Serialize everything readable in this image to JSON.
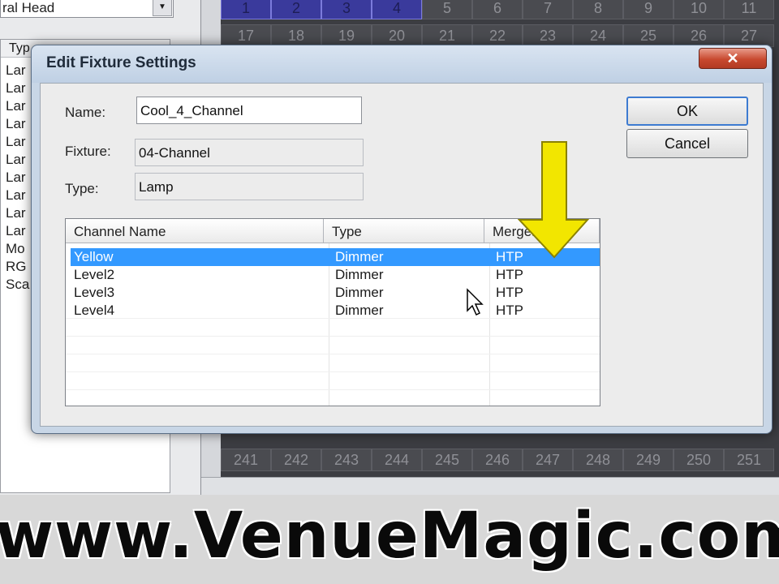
{
  "background": {
    "fixture_combo_text": "ral Head",
    "list_header": "Typ",
    "list_items": [
      "Lar",
      "Lar",
      "Lar",
      "Lar",
      "Lar",
      "Lar",
      "Lar",
      "Lar",
      "Lar",
      "Lar",
      "Mo",
      "RG",
      "Sca"
    ],
    "grid_top_rows": [
      [
        "1",
        "2",
        "3",
        "4",
        "5",
        "6",
        "7",
        "8",
        "9",
        "10",
        "11"
      ],
      [
        "17",
        "18",
        "19",
        "20",
        "21",
        "22",
        "23",
        "24",
        "25",
        "26",
        "27"
      ]
    ],
    "grid_bottom_row": [
      "241",
      "242",
      "243",
      "244",
      "245",
      "246",
      "247",
      "248",
      "249",
      "250",
      "251"
    ]
  },
  "dialog": {
    "title": "Edit Fixture Settings",
    "close_glyph": "✕",
    "name_label": "Name:",
    "name_value": "Cool_4_Channel",
    "fixture_label": "Fixture:",
    "fixture_value": "04-Channel",
    "type_label": "Type:",
    "type_value": "Lamp",
    "ok_label": "OK",
    "cancel_label": "Cancel",
    "table": {
      "columns": [
        "Channel Name",
        "Type",
        "MergeMode"
      ],
      "rows": [
        {
          "name": "Yellow",
          "type": "Dimmer",
          "merge": "HTP"
        },
        {
          "name": "Level2",
          "type": "Dimmer",
          "merge": "HTP"
        },
        {
          "name": "Level3",
          "type": "Dimmer",
          "merge": "HTP"
        },
        {
          "name": "Level4",
          "type": "Dimmer",
          "merge": "HTP"
        }
      ],
      "selected_index": 0
    }
  },
  "watermark": "www.VenueMagic.com",
  "colors": {
    "arrow": "#f2e600",
    "selection": "#3399ff",
    "grid_selected": "#3a3a9c"
  }
}
